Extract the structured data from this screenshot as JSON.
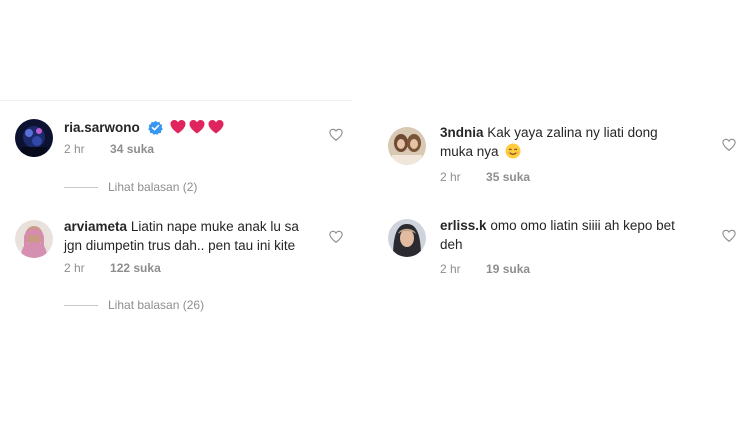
{
  "left_panel": {
    "comments": [
      {
        "username": "ria.sarwono",
        "text": "",
        "time": "2 hr",
        "likes": "34 suka",
        "replies": "Lihat balasan (2)",
        "verified": true,
        "reaction_icons": [
          "heart-emoji",
          "heart-emoji",
          "heart-emoji"
        ]
      },
      {
        "username": "arviameta",
        "text_line1": "Liatin nape muke anak lu sa",
        "text_line2": "jgn diumpetin trus dah.. pen tau ini kite",
        "time": "2 hr",
        "likes": "122 suka",
        "replies": "Lihat balasan (26)"
      }
    ]
  },
  "right_panel": {
    "comments": [
      {
        "username": "3ndnia",
        "text_line1": "Kak yaya zalina ny liati dong",
        "text_line2": "muka nya",
        "emoji": "smiling-face-emoji",
        "time": "2 hr",
        "likes": "35 suka"
      },
      {
        "username": "erliss.k",
        "text_line1": "omo omo liatin siiii ah kepo bet",
        "text_line2": "deh",
        "time": "2 hr",
        "likes": "19 suka"
      }
    ]
  },
  "colors": {
    "text": "#262626",
    "secondary": "#8e8e8e",
    "verified": "#3897f0",
    "heart_emoji": "#e0245e"
  }
}
